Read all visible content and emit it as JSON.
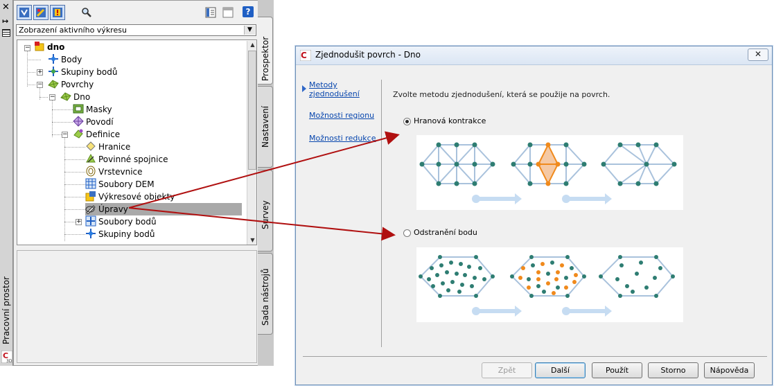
{
  "palette": {
    "view_select": "Zobrazení aktivního výkresu",
    "workspace_label": "Pracovní prostor",
    "tabs": [
      "Prospektor",
      "Nastavení",
      "Survey",
      "Sada nástrojů"
    ],
    "tree": {
      "root": "dno",
      "items": [
        "Body",
        "Skupiny bodů",
        "Povrchy",
        "Dno",
        "Masky",
        "Povodí",
        "Definice",
        "Hranice",
        "Povinné spojnice",
        "Vrstevnice",
        "Soubory DEM",
        "Výkresové objekty",
        "Úpravy",
        "Soubory bodů",
        "Skupiny bodů"
      ],
      "selected": "Úpravy"
    },
    "icons": [
      "close-icon",
      "autohide-icon",
      "properties-icon",
      "tree-view-icon",
      "edit-icon",
      "warning-icon",
      "search-icon",
      "list-view-icon",
      "item-view-icon",
      "help-icon"
    ]
  },
  "dialog": {
    "title": "Zjednodušit povrch - Dno",
    "close_label": "✕",
    "nav": [
      "Metody zjednodušení",
      "Možnosti regionu",
      "Možnosti redukce"
    ],
    "active_nav": "Metody zjednodušení",
    "instruction": "Zvolte metodu zjednodušení, která se použije na povrch.",
    "options": [
      {
        "label": "Hranová kontrakce",
        "selected": true
      },
      {
        "label": "Odstranění bodu",
        "selected": false
      }
    ],
    "buttons": {
      "back": "Zpět",
      "next": "Další",
      "apply": "Použít",
      "cancel": "Storno",
      "help": "Nápověda"
    }
  },
  "colors": {
    "accent_orange": "#f08a1c",
    "node_teal": "#2e7d72",
    "edge_blue": "#a9c2dc",
    "arrow_red": "#b01010",
    "link_blue": "#0645ad"
  }
}
